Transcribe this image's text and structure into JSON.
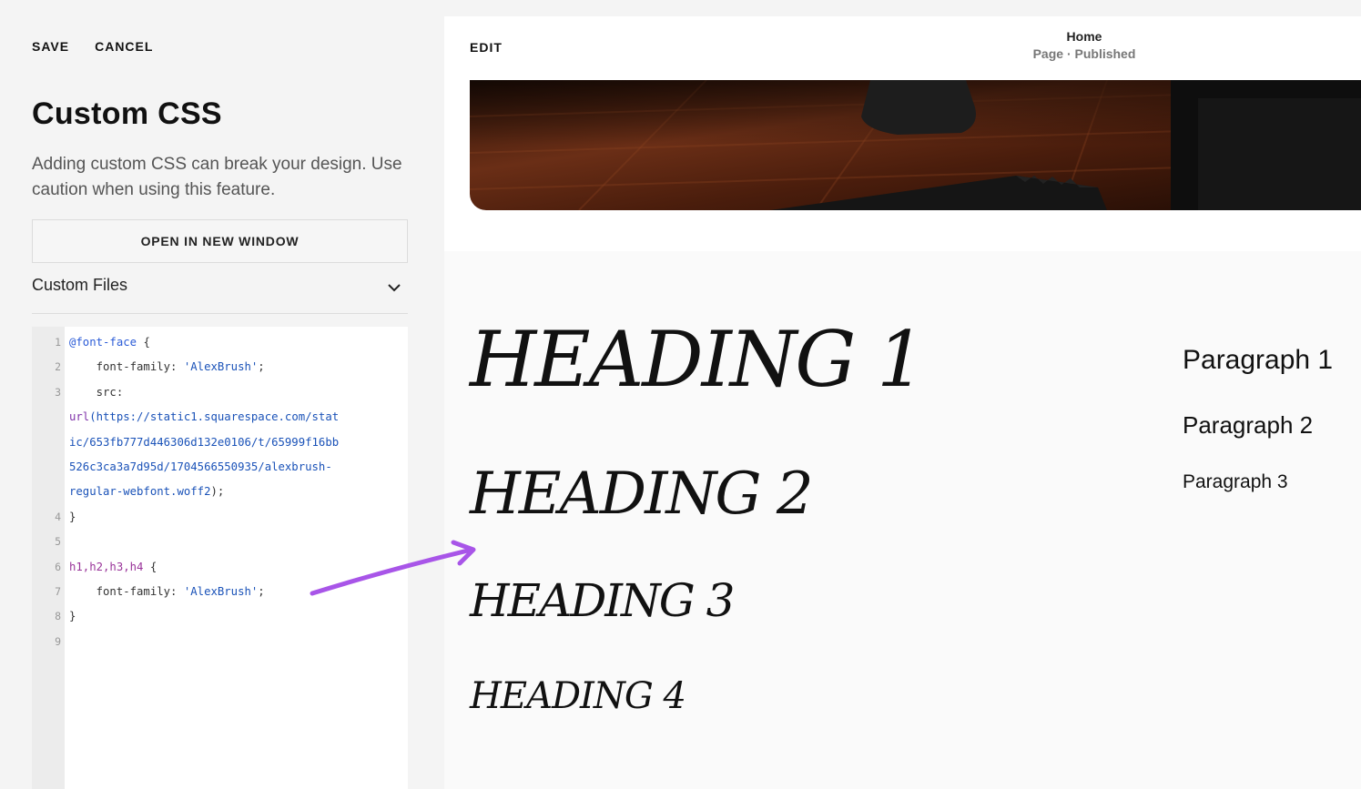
{
  "left_panel": {
    "save_label": "SAVE",
    "cancel_label": "CANCEL",
    "title": "Custom CSS",
    "description": "Adding custom CSS can break your design. Use caution when using this feature.",
    "open_button": "OPEN IN NEW WINDOW",
    "custom_files_label": "Custom Files"
  },
  "editor": {
    "lines": [
      {
        "n": "1",
        "parts": [
          [
            "at",
            "@font-face"
          ],
          [
            "plain",
            " {"
          ]
        ]
      },
      {
        "n": "2",
        "parts": [
          [
            "plain",
            "    font-family: "
          ],
          [
            "str",
            "'AlexBrush'"
          ],
          [
            "plain",
            ";"
          ]
        ]
      },
      {
        "n": "3",
        "parts": [
          [
            "plain",
            "    src:"
          ]
        ]
      },
      {
        "n": "",
        "parts": [
          [
            "kw",
            "url"
          ],
          [
            "url",
            "(https://static1.squarespace.com/stat"
          ]
        ]
      },
      {
        "n": "",
        "parts": [
          [
            "url",
            "ic/653fb777d446306d132e0106/t/65999f16bb"
          ]
        ]
      },
      {
        "n": "",
        "parts": [
          [
            "url",
            "526c3ca3a7d95d/1704566550935/alexbrush-"
          ]
        ]
      },
      {
        "n": "",
        "parts": [
          [
            "url",
            "regular-webfont.woff2"
          ],
          [
            "plain",
            ");"
          ]
        ]
      },
      {
        "n": "4",
        "parts": [
          [
            "plain",
            "}"
          ]
        ]
      },
      {
        "n": "5",
        "parts": []
      },
      {
        "n": "6",
        "parts": [
          [
            "sel",
            "h1,h2,h3,h4"
          ],
          [
            "plain",
            " {"
          ]
        ]
      },
      {
        "n": "7",
        "parts": [
          [
            "plain",
            "    font-family: "
          ],
          [
            "str",
            "'AlexBrush'"
          ],
          [
            "plain",
            ";"
          ]
        ]
      },
      {
        "n": "8",
        "parts": [
          [
            "plain",
            "}"
          ]
        ]
      },
      {
        "n": "9",
        "parts": []
      }
    ]
  },
  "preview": {
    "edit_label": "EDIT",
    "page_name": "Home",
    "page_status": "Page · Published",
    "headings": [
      "HEADING 1",
      "HEADING 2",
      "HEADING 3",
      "HEADING 4"
    ],
    "paragraphs": [
      "Paragraph 1",
      "Paragraph 2",
      "Paragraph 3"
    ]
  },
  "colors": {
    "arrow": "#a855e8",
    "accent_code": "#1a52b8"
  }
}
